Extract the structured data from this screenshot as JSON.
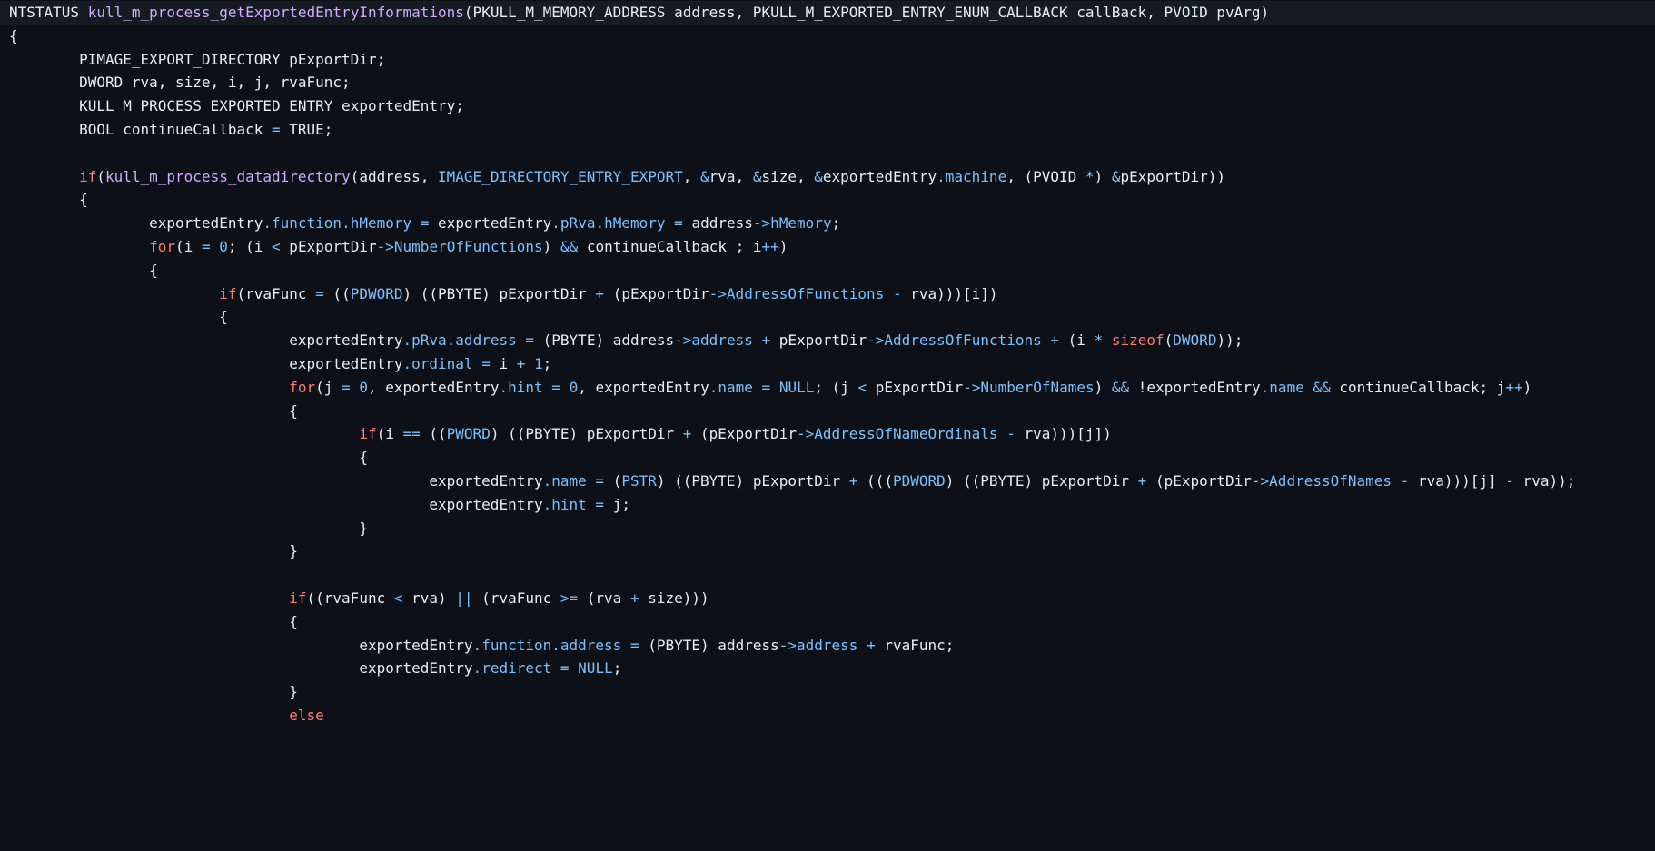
{
  "editor": {
    "language": "c",
    "colors": {
      "background": "#0d1117",
      "first_line_background": "#161b22",
      "plain": "#e6edf3",
      "keyword": "#ff7b72",
      "function": "#d2a8ff",
      "type_or_property": "#79c0ff"
    },
    "lines": [
      {
        "indent": 0,
        "tokens": [
          [
            "plain",
            "NTSTATUS "
          ],
          [
            "fn",
            "kull_m_process_getExportedEntryInformations"
          ],
          [
            "plain",
            "(PKULL_M_MEMORY_ADDRESS address, PKULL_M_EXPORTED_ENTRY_ENUM_CALLBACK callBack, PVOID pvArg)"
          ]
        ]
      },
      {
        "indent": 0,
        "tokens": [
          [
            "plain",
            "{"
          ]
        ]
      },
      {
        "indent": 1,
        "tokens": [
          [
            "plain",
            "PIMAGE_EXPORT_DIRECTORY pExportDir;"
          ]
        ]
      },
      {
        "indent": 1,
        "tokens": [
          [
            "plain",
            "DWORD rva, size, i, j, rvaFunc;"
          ]
        ]
      },
      {
        "indent": 1,
        "tokens": [
          [
            "plain",
            "KULL_M_PROCESS_EXPORTED_ENTRY exportedEntry;"
          ]
        ]
      },
      {
        "indent": 1,
        "tokens": [
          [
            "plain",
            "BOOL continueCallback "
          ],
          [
            "op",
            "="
          ],
          [
            "plain",
            " TRUE;"
          ]
        ]
      },
      {
        "indent": 0,
        "tokens": []
      },
      {
        "indent": 1,
        "tokens": [
          [
            "kw",
            "if"
          ],
          [
            "plain",
            "("
          ],
          [
            "fn",
            "kull_m_process_datadirectory"
          ],
          [
            "plain",
            "(address, "
          ],
          [
            "const",
            "IMAGE_DIRECTORY_ENTRY_EXPORT"
          ],
          [
            "plain",
            ", "
          ],
          [
            "op",
            "&"
          ],
          [
            "plain",
            "rva, "
          ],
          [
            "op",
            "&"
          ],
          [
            "plain",
            "size, "
          ],
          [
            "op",
            "&"
          ],
          [
            "plain",
            "exportedEntry"
          ],
          [
            "op",
            "."
          ],
          [
            "prop",
            "machine"
          ],
          [
            "plain",
            ", (PVOID "
          ],
          [
            "op",
            "*"
          ],
          [
            "plain",
            ") "
          ],
          [
            "op",
            "&"
          ],
          [
            "plain",
            "pExportDir))"
          ]
        ]
      },
      {
        "indent": 1,
        "tokens": [
          [
            "plain",
            "{"
          ]
        ]
      },
      {
        "indent": 2,
        "tokens": [
          [
            "plain",
            "exportedEntry"
          ],
          [
            "op",
            "."
          ],
          [
            "prop",
            "function"
          ],
          [
            "op",
            "."
          ],
          [
            "prop",
            "hMemory"
          ],
          [
            "plain",
            " "
          ],
          [
            "op",
            "="
          ],
          [
            "plain",
            " exportedEntry"
          ],
          [
            "op",
            "."
          ],
          [
            "prop",
            "pRva"
          ],
          [
            "op",
            "."
          ],
          [
            "prop",
            "hMemory"
          ],
          [
            "plain",
            " "
          ],
          [
            "op",
            "="
          ],
          [
            "plain",
            " address"
          ],
          [
            "op",
            "->"
          ],
          [
            "prop",
            "hMemory"
          ],
          [
            "plain",
            ";"
          ]
        ]
      },
      {
        "indent": 2,
        "tokens": [
          [
            "kw",
            "for"
          ],
          [
            "plain",
            "(i "
          ],
          [
            "op",
            "="
          ],
          [
            "plain",
            " "
          ],
          [
            "num",
            "0"
          ],
          [
            "plain",
            "; (i "
          ],
          [
            "op",
            "<"
          ],
          [
            "plain",
            " pExportDir"
          ],
          [
            "op",
            "->"
          ],
          [
            "prop",
            "NumberOfFunctions"
          ],
          [
            "plain",
            ") "
          ],
          [
            "op",
            "&&"
          ],
          [
            "plain",
            " continueCallback ; i"
          ],
          [
            "op",
            "++"
          ],
          [
            "plain",
            ")"
          ]
        ]
      },
      {
        "indent": 2,
        "tokens": [
          [
            "plain",
            "{"
          ]
        ]
      },
      {
        "indent": 3,
        "tokens": [
          [
            "kw",
            "if"
          ],
          [
            "plain",
            "(rvaFunc "
          ],
          [
            "op",
            "="
          ],
          [
            "plain",
            " (("
          ],
          [
            "type",
            "PDWORD"
          ],
          [
            "plain",
            ") ((PBYTE) pExportDir "
          ],
          [
            "op",
            "+"
          ],
          [
            "plain",
            " (pExportDir"
          ],
          [
            "op",
            "->"
          ],
          [
            "prop",
            "AddressOfFunctions"
          ],
          [
            "plain",
            " "
          ],
          [
            "op",
            "-"
          ],
          [
            "plain",
            " rva)))[i])"
          ]
        ]
      },
      {
        "indent": 3,
        "tokens": [
          [
            "plain",
            "{"
          ]
        ]
      },
      {
        "indent": 4,
        "tokens": [
          [
            "plain",
            "exportedEntry"
          ],
          [
            "op",
            "."
          ],
          [
            "prop",
            "pRva"
          ],
          [
            "op",
            "."
          ],
          [
            "prop",
            "address"
          ],
          [
            "plain",
            " "
          ],
          [
            "op",
            "="
          ],
          [
            "plain",
            " (PBYTE) address"
          ],
          [
            "op",
            "->"
          ],
          [
            "prop",
            "address"
          ],
          [
            "plain",
            " "
          ],
          [
            "op",
            "+"
          ],
          [
            "plain",
            " pExportDir"
          ],
          [
            "op",
            "->"
          ],
          [
            "prop",
            "AddressOfFunctions"
          ],
          [
            "plain",
            " "
          ],
          [
            "op",
            "+"
          ],
          [
            "plain",
            " (i "
          ],
          [
            "op",
            "*"
          ],
          [
            "plain",
            " "
          ],
          [
            "kw",
            "sizeof"
          ],
          [
            "plain",
            "("
          ],
          [
            "type",
            "DWORD"
          ],
          [
            "plain",
            "));"
          ]
        ]
      },
      {
        "indent": 4,
        "tokens": [
          [
            "plain",
            "exportedEntry"
          ],
          [
            "op",
            "."
          ],
          [
            "prop",
            "ordinal"
          ],
          [
            "plain",
            " "
          ],
          [
            "op",
            "="
          ],
          [
            "plain",
            " i "
          ],
          [
            "op",
            "+"
          ],
          [
            "plain",
            " "
          ],
          [
            "num",
            "1"
          ],
          [
            "plain",
            ";"
          ]
        ]
      },
      {
        "indent": 4,
        "tokens": [
          [
            "kw",
            "for"
          ],
          [
            "plain",
            "(j "
          ],
          [
            "op",
            "="
          ],
          [
            "plain",
            " "
          ],
          [
            "num",
            "0"
          ],
          [
            "plain",
            ", exportedEntry"
          ],
          [
            "op",
            "."
          ],
          [
            "prop",
            "hint"
          ],
          [
            "plain",
            " "
          ],
          [
            "op",
            "="
          ],
          [
            "plain",
            " "
          ],
          [
            "num",
            "0"
          ],
          [
            "plain",
            ", exportedEntry"
          ],
          [
            "op",
            "."
          ],
          [
            "prop",
            "name"
          ],
          [
            "plain",
            " "
          ],
          [
            "op",
            "="
          ],
          [
            "plain",
            " "
          ],
          [
            "const",
            "NULL"
          ],
          [
            "plain",
            "; (j "
          ],
          [
            "op",
            "<"
          ],
          [
            "plain",
            " pExportDir"
          ],
          [
            "op",
            "->"
          ],
          [
            "prop",
            "NumberOfNames"
          ],
          [
            "plain",
            ") "
          ],
          [
            "op",
            "&&"
          ],
          [
            "plain",
            " !exportedEntry"
          ],
          [
            "op",
            "."
          ],
          [
            "prop",
            "name"
          ],
          [
            "plain",
            " "
          ],
          [
            "op",
            "&&"
          ],
          [
            "plain",
            " continueCallback; j"
          ],
          [
            "op",
            "++"
          ],
          [
            "plain",
            ")"
          ]
        ]
      },
      {
        "indent": 4,
        "tokens": [
          [
            "plain",
            "{"
          ]
        ]
      },
      {
        "indent": 5,
        "tokens": [
          [
            "kw",
            "if"
          ],
          [
            "plain",
            "(i "
          ],
          [
            "op",
            "=="
          ],
          [
            "plain",
            " (("
          ],
          [
            "type",
            "PWORD"
          ],
          [
            "plain",
            ") ((PBYTE) pExportDir "
          ],
          [
            "op",
            "+"
          ],
          [
            "plain",
            " (pExportDir"
          ],
          [
            "op",
            "->"
          ],
          [
            "prop",
            "AddressOfNameOrdinals"
          ],
          [
            "plain",
            " "
          ],
          [
            "op",
            "-"
          ],
          [
            "plain",
            " rva)))[j])"
          ]
        ]
      },
      {
        "indent": 5,
        "tokens": [
          [
            "plain",
            "{"
          ]
        ]
      },
      {
        "indent": 6,
        "tokens": [
          [
            "plain",
            "exportedEntry"
          ],
          [
            "op",
            "."
          ],
          [
            "prop",
            "name"
          ],
          [
            "plain",
            " "
          ],
          [
            "op",
            "="
          ],
          [
            "plain",
            " ("
          ],
          [
            "type",
            "PSTR"
          ],
          [
            "plain",
            ") ((PBYTE) pExportDir "
          ],
          [
            "op",
            "+"
          ],
          [
            "plain",
            " ((("
          ],
          [
            "type",
            "PDWORD"
          ],
          [
            "plain",
            ") ((PBYTE) pExportDir "
          ],
          [
            "op",
            "+"
          ],
          [
            "plain",
            " (pExportDir"
          ],
          [
            "op",
            "->"
          ],
          [
            "prop",
            "AddressOfNames"
          ],
          [
            "plain",
            " "
          ],
          [
            "op",
            "-"
          ],
          [
            "plain",
            " rva)))[j] "
          ],
          [
            "op",
            "-"
          ],
          [
            "plain",
            " rva));"
          ]
        ]
      },
      {
        "indent": 6,
        "tokens": [
          [
            "plain",
            "exportedEntry"
          ],
          [
            "op",
            "."
          ],
          [
            "prop",
            "hint"
          ],
          [
            "plain",
            " "
          ],
          [
            "op",
            "="
          ],
          [
            "plain",
            " j;"
          ]
        ]
      },
      {
        "indent": 5,
        "tokens": [
          [
            "plain",
            "}"
          ]
        ]
      },
      {
        "indent": 4,
        "tokens": [
          [
            "plain",
            "}"
          ]
        ]
      },
      {
        "indent": 0,
        "tokens": []
      },
      {
        "indent": 4,
        "tokens": [
          [
            "kw",
            "if"
          ],
          [
            "plain",
            "((rvaFunc "
          ],
          [
            "op",
            "<"
          ],
          [
            "plain",
            " rva) "
          ],
          [
            "op",
            "||"
          ],
          [
            "plain",
            " (rvaFunc "
          ],
          [
            "op",
            ">="
          ],
          [
            "plain",
            " (rva "
          ],
          [
            "op",
            "+"
          ],
          [
            "plain",
            " size)))"
          ]
        ]
      },
      {
        "indent": 4,
        "tokens": [
          [
            "plain",
            "{"
          ]
        ]
      },
      {
        "indent": 5,
        "tokens": [
          [
            "plain",
            "exportedEntry"
          ],
          [
            "op",
            "."
          ],
          [
            "prop",
            "function"
          ],
          [
            "op",
            "."
          ],
          [
            "prop",
            "address"
          ],
          [
            "plain",
            " "
          ],
          [
            "op",
            "="
          ],
          [
            "plain",
            " (PBYTE) address"
          ],
          [
            "op",
            "->"
          ],
          [
            "prop",
            "address"
          ],
          [
            "plain",
            " "
          ],
          [
            "op",
            "+"
          ],
          [
            "plain",
            " rvaFunc;"
          ]
        ]
      },
      {
        "indent": 5,
        "tokens": [
          [
            "plain",
            "exportedEntry"
          ],
          [
            "op",
            "."
          ],
          [
            "prop",
            "redirect"
          ],
          [
            "plain",
            " "
          ],
          [
            "op",
            "="
          ],
          [
            "plain",
            " "
          ],
          [
            "const",
            "NULL"
          ],
          [
            "plain",
            ";"
          ]
        ]
      },
      {
        "indent": 4,
        "tokens": [
          [
            "plain",
            "}"
          ]
        ]
      },
      {
        "indent": 4,
        "tokens": [
          [
            "kw",
            "else"
          ]
        ]
      }
    ]
  }
}
